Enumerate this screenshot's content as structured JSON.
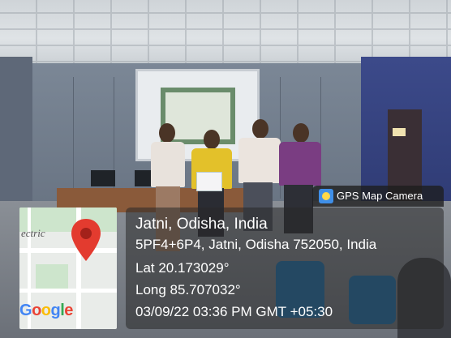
{
  "stamp": {
    "badge_label": "GPS Map Camera",
    "title": "Jatni, Odisha, India",
    "address": "5PF4+6P4, Jatni, Odisha 752050, India",
    "latitude": "Lat 20.173029°",
    "longitude": "Long 85.707032°",
    "datetime": "03/09/22 03:36 PM GMT +05:30"
  },
  "map": {
    "partial_label": "ectric",
    "google_letters": [
      "G",
      "o",
      "o",
      "g",
      "l",
      "e"
    ],
    "google_colors": [
      "#4285F4",
      "#EA4335",
      "#FBBC05",
      "#4285F4",
      "#34A853",
      "#EA4335"
    ],
    "pin_color": "#e33b2f"
  },
  "scene_colors": {
    "wall": "#6f7b8a",
    "accent_wall": "#2f3b74",
    "panel_bg": "#282828"
  }
}
